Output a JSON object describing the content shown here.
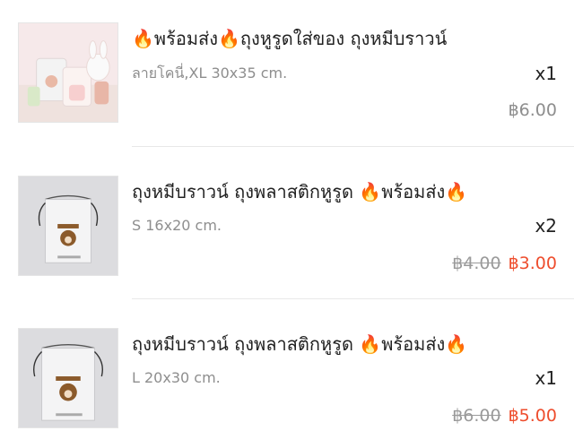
{
  "items": [
    {
      "title": "🔥พร้อมส่ง🔥ถุงหูรูดใส่ของ ถุงหมีบราวน์",
      "variant": "ลายโคนี่,XL 30x35 cm.",
      "quantity": "x1",
      "price": "฿6.00",
      "original_price": ""
    },
    {
      "title": "ถุงหมีบราวน์ ถุงพลาสติกหูรูด 🔥พร้อมส่ง🔥",
      "variant": "S 16x20 cm.",
      "quantity": "x2",
      "price": "฿3.00",
      "original_price": "฿4.00"
    },
    {
      "title": "ถุงหมีบราวน์ ถุงพลาสติกหูรูด 🔥พร้อมส่ง🔥",
      "variant": "L 20x30 cm.",
      "quantity": "x1",
      "price": "฿5.00",
      "original_price": "฿6.00"
    }
  ],
  "colors": {
    "sale_price": "#ee4d2d",
    "regular_price": "#8e8e8e"
  }
}
